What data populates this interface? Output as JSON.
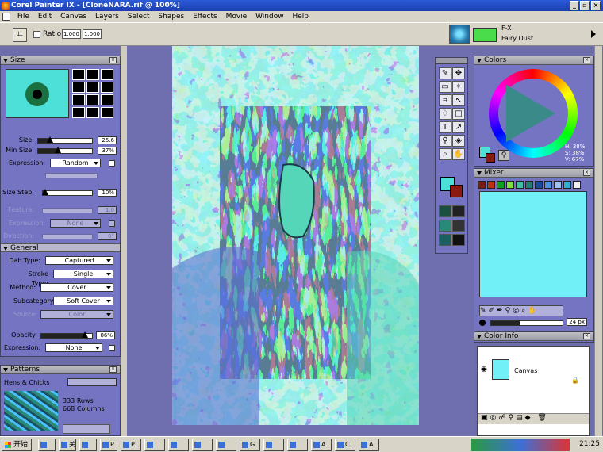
{
  "window": {
    "title": "Corel Painter IX - [CloneNARA.rif @ 100%]",
    "minimize": "_",
    "restore": "▫",
    "close": "×"
  },
  "menu": [
    "File",
    "Edit",
    "Canvas",
    "Layers",
    "Select",
    "Shapes",
    "Effects",
    "Movie",
    "Window",
    "Help"
  ],
  "propbar": {
    "ratio_label": "Ratio:",
    "ratio_w": "1.000",
    "ratio_h": "1.000",
    "brush_category": "F-X",
    "brush_variant": "Fairy Dust"
  },
  "size_palette": {
    "title": "Size",
    "size_label": "Size:",
    "size_value": "25.6",
    "size_fraction": 0.22,
    "minsize_label": "Min Size:",
    "minsize_value": "37%",
    "minsize_fraction": 0.37,
    "expression_label": "Expression:",
    "expression_value": "Random",
    "size_step_label": "Size Step:",
    "size_step_value": "10%",
    "size_step_fraction": 0.05,
    "feature_label": "Feature:",
    "feature_value": "1.0",
    "expression2_label": "Expression:",
    "expression2_value": "None",
    "direction_label": "Direction:",
    "direction_value": "0°"
  },
  "general_palette": {
    "title": "General",
    "dab_type_label": "Dab Type:",
    "dab_type_value": "Captured",
    "stroke_type_label": "Stroke Type:",
    "stroke_type_value": "Single",
    "method_label": "Method:",
    "method_value": "Cover",
    "subcategory_label": "Subcategory:",
    "subcategory_value": "Soft Cover",
    "source_label": "Source:",
    "source_value": "Color",
    "opacity_label": "Opacity:",
    "opacity_value": "86%",
    "opacity_fraction": 0.86,
    "expression_label": "Expression:",
    "expression_value": "None"
  },
  "patterns_palette": {
    "title": "Patterns",
    "pattern_name": "Hens & Chicks",
    "rows": "333 Rows",
    "columns": "668 Columns"
  },
  "colors_palette": {
    "title": "Colors",
    "hsv": [
      "H: 38%",
      "S: 38%",
      "V: 67%"
    ],
    "main_color": "#4de0d8",
    "additional_color": "#8b1a10"
  },
  "mixer_palette": {
    "title": "Mixer",
    "swatches": [
      "#7a1a10",
      "#c03010",
      "#10a020",
      "#80e040",
      "#40c0a0",
      "#208070",
      "#1a4a9a",
      "#5090e0",
      "#a0c0f0",
      "#30b0d0",
      "#f0f0f0"
    ],
    "brush_size": "24 px"
  },
  "colorinfo_palette": {
    "title": "Color Info"
  },
  "layers_palette": {
    "layer_name": "Canvas"
  },
  "taskbar": {
    "start_label": "开始",
    "items": [
      "",
      "关",
      "",
      "P..",
      "P..",
      "",
      "",
      "",
      "",
      "G..",
      "",
      "",
      "A..",
      "C..",
      "A.."
    ],
    "clock": "21:25"
  }
}
